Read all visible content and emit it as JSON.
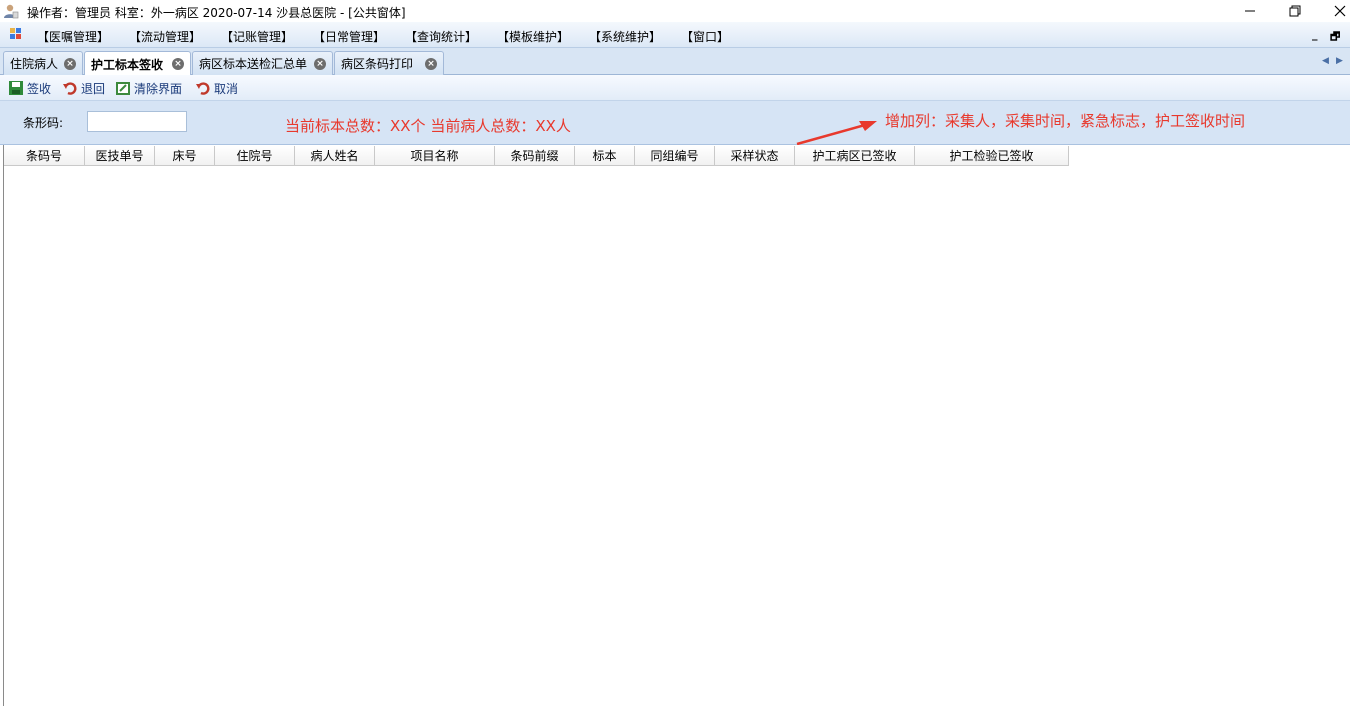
{
  "titlebar": {
    "title": "操作者：管理员  科室：外一病区  2020-07-14  沙县总医院 - [公共窗体]",
    "icons": [
      "app-user-icon",
      "minimize-icon",
      "restore-icon",
      "close-icon"
    ]
  },
  "menubar": {
    "items": [
      "【医嘱管理】",
      "【流动管理】",
      "【记账管理】",
      "【日常管理】",
      "【查询统计】",
      "【模板维护】",
      "【系统维护】",
      "【窗口】"
    ],
    "mdi_minimize": "_",
    "mdi_restore": "🗗"
  },
  "tabs": [
    {
      "label": "住院病人",
      "active": false
    },
    {
      "label": "护工标本签收",
      "active": true
    },
    {
      "label": "病区标本送检汇总单",
      "active": false
    },
    {
      "label": "病区条码打印",
      "active": false
    }
  ],
  "toolbar": {
    "items": [
      {
        "label": "签收",
        "icon": "save-icon"
      },
      {
        "label": "退回",
        "icon": "undo-icon"
      },
      {
        "label": "清除界面",
        "icon": "clear-icon"
      },
      {
        "label": "取消",
        "icon": "undo-icon"
      }
    ]
  },
  "filter": {
    "barcode_label": "条形码:",
    "barcode_value": ""
  },
  "annotations": {
    "summary": "当前标本总数：XX个    当前病人总数：XX人",
    "note": "增加列：采集人，采集时间，紧急标志，护工签收时间",
    "color": "#e8392d"
  },
  "grid": {
    "columns": [
      "条码号",
      "医技单号",
      "床号",
      "住院号",
      "病人姓名",
      "项目名称",
      "条码前缀",
      "标本",
      "同组编号",
      "采样状态",
      "护工病区已签收",
      "护工检验已签收"
    ],
    "rows": []
  }
}
